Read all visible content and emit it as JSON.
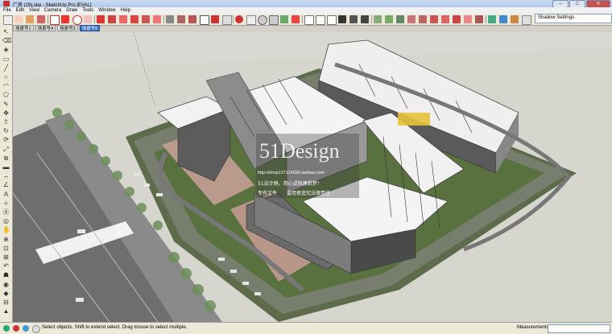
{
  "window": {
    "title": "厂房 (29).skp - SketchUp Pro [EVAL]",
    "minimize": "–",
    "maximize": "□",
    "close": "✕"
  },
  "menu": [
    "File",
    "Edit",
    "View",
    "Camera",
    "Draw",
    "Tools",
    "Window",
    "Help"
  ],
  "shadow_settings": {
    "label": "Shadow Settings"
  },
  "scenes": [
    "场景号1",
    "场景号4",
    "场景号3",
    "场景号5"
  ],
  "active_scene_index": 3,
  "left_tools": [
    "select-arrow-icon",
    "eraser-icon",
    "paint-bucket-icon",
    "rectangle-icon",
    "line-icon",
    "circle-icon",
    "arc-icon",
    "polygon-icon",
    "freehand-icon",
    "move-icon",
    "push-pull-icon",
    "rotate-icon",
    "follow-me-icon",
    "scale-icon",
    "offset-icon",
    "tape-measure-icon",
    "dimension-icon",
    "protractor-icon",
    "text-icon",
    "axes-icon",
    "3d-text-icon",
    "orbit-icon",
    "pan-icon",
    "zoom-icon",
    "zoom-window-icon",
    "zoom-extents-icon",
    "previous-view-icon",
    "walk-icon",
    "look-around-icon",
    "position-camera-icon",
    "section-plane-icon",
    "sandbox-icon"
  ],
  "watermark": {
    "logo": "51Design",
    "url": "http://shop127114090.taobao.com",
    "line1": "51设计网，用心成就建筑梦！",
    "line2": "专有文件　　盗用者追究法律责任"
  },
  "status": {
    "text": "Select objects. Shift to extend select. Drag mouse to select multiple.",
    "measurements_label": "Measurements"
  }
}
